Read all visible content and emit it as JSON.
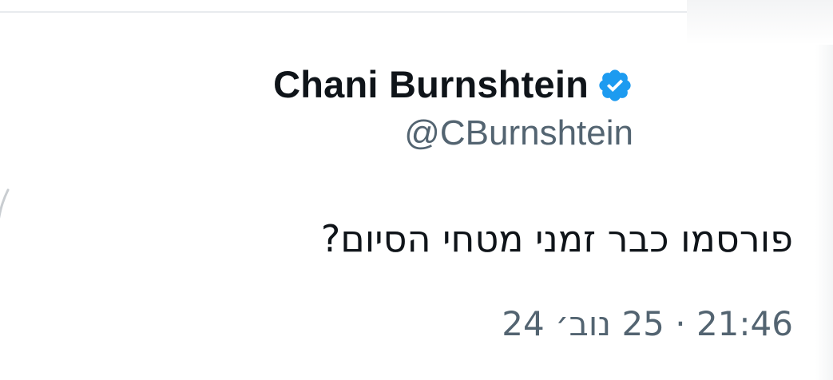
{
  "tweet": {
    "author": {
      "display_name": "Chani Burnshtein",
      "handle": "@CBurnshtein",
      "verified_icon": "verified-badge-icon",
      "verified_color": "#1d9bf0"
    },
    "text": "פורסמו כבר זמני מטחי הסיום?",
    "timestamp": "21:46 · 25 נוב׳ 24"
  },
  "colors": {
    "text_primary": "#0f1419",
    "text_secondary": "#536471",
    "divider": "#e8ebee"
  }
}
